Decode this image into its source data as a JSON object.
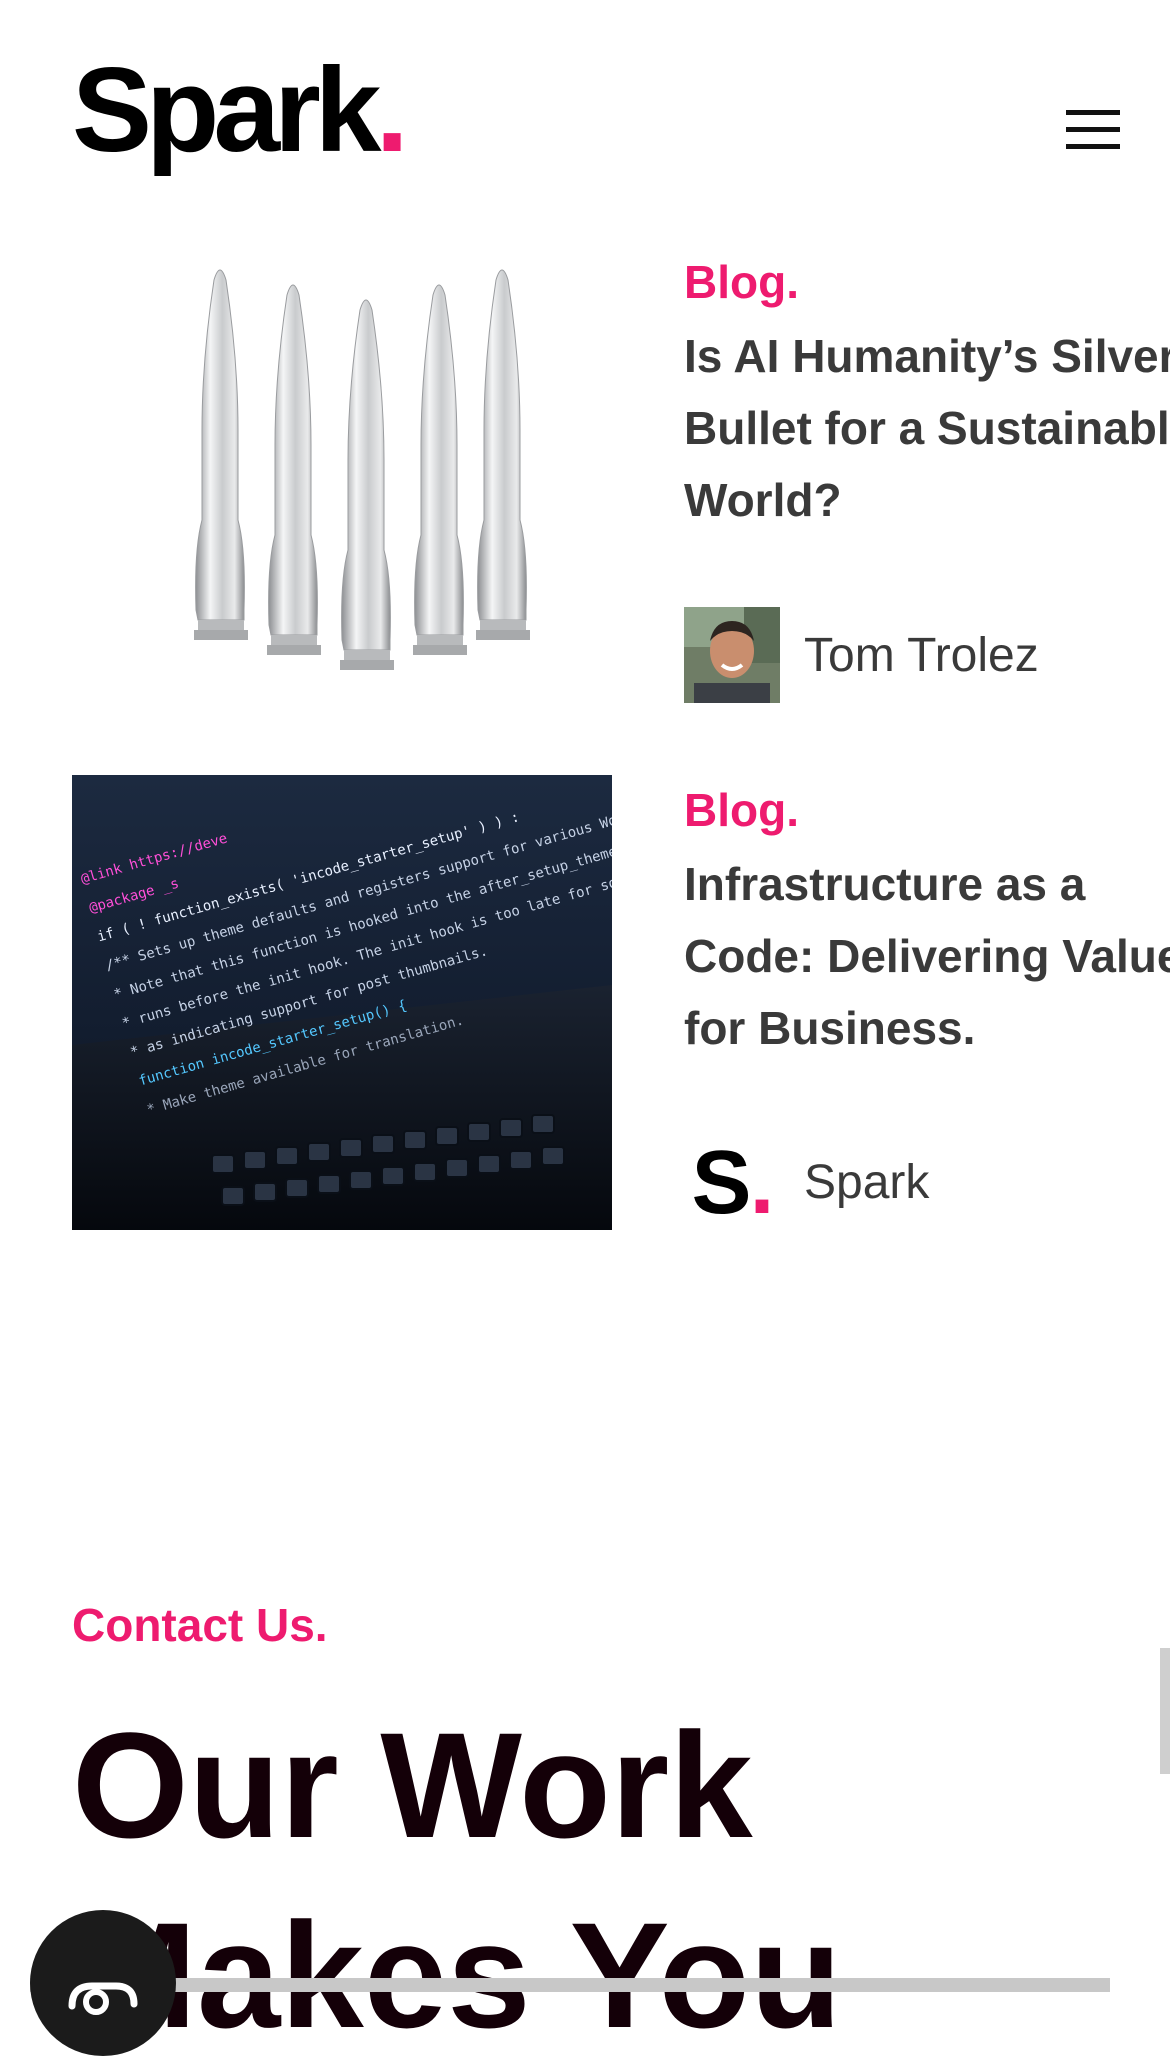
{
  "header": {
    "logo_text": "Spark",
    "logo_dot": ".",
    "menu_icon": "hamburger-menu-icon"
  },
  "posts": [
    {
      "tag": "Blog.",
      "title_lines": [
        "Is AI Humanity’s Silver",
        "Bullet for a Sustainable",
        "World?"
      ],
      "image": "silver-bullets-image",
      "author": {
        "name": "Tom Trolez",
        "avatar": "author-photo"
      }
    },
    {
      "tag": "Blog.",
      "title_lines": [
        "Infrastructure as a",
        "Code: Delivering Value",
        "for Business."
      ],
      "image": "laptop-code-image",
      "code_lines": [
        "@link https://deve",
        "@package _s",
        "if ( ! function_exists( 'incode_starter_setup' ) ) :",
        "/** Sets up theme defaults and registers support for various WordPr",
        " * Note that this function is hooked into the after_setup_theme hoo",
        " * runs before the init hook. The init hook is too late for some fe",
        " * as indicating support for post thumbnails.",
        "function incode_starter_setup() {",
        " * Make theme available for translation."
      ],
      "author": {
        "name": "Spark",
        "avatar_letter": "S",
        "avatar_dot": "."
      }
    }
  ],
  "contact": {
    "label": "Contact Us.",
    "headline_lines": [
      "Our Work",
      "Makes You"
    ]
  },
  "chat_widget_icon": "chat-support-icon",
  "colors": {
    "accent": "#ee1b6f",
    "title_text": "#3a3a3a",
    "headline": "#140008"
  }
}
